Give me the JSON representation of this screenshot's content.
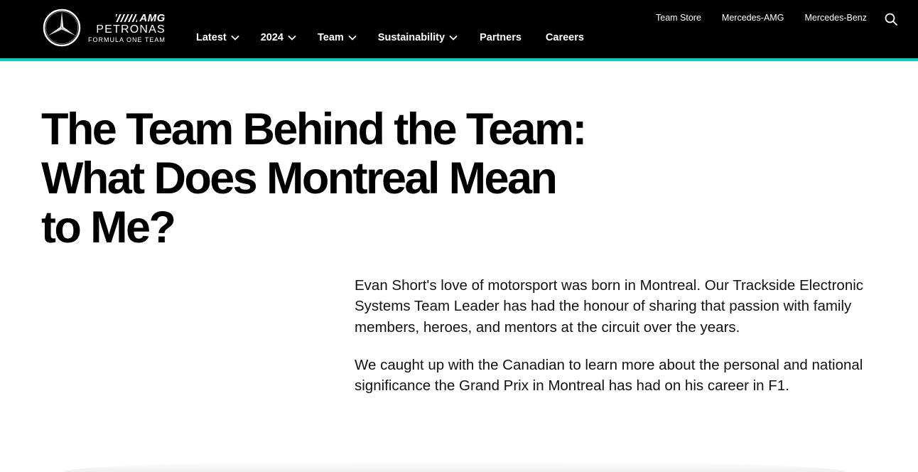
{
  "brand": {
    "amg": "AMG",
    "petronas": "PETRONAS",
    "subtitle": "FORMULA ONE TEAM"
  },
  "colors": {
    "header_bg": "#000000",
    "accent": "#00d2be",
    "text": "#000000"
  },
  "main_nav": {
    "items": [
      {
        "label": "Latest",
        "has_dropdown": true
      },
      {
        "label": "2024",
        "has_dropdown": true
      },
      {
        "label": "Team",
        "has_dropdown": true
      },
      {
        "label": "Sustainability",
        "has_dropdown": true
      },
      {
        "label": "Partners",
        "has_dropdown": false
      },
      {
        "label": "Careers",
        "has_dropdown": false
      }
    ]
  },
  "utility_nav": {
    "items": [
      {
        "label": "Team Store"
      },
      {
        "label": "Mercedes-AMG"
      },
      {
        "label": "Mercedes-Benz"
      }
    ],
    "search_icon": "search-icon"
  },
  "article": {
    "title_lines": [
      "The Team Behind the Team:",
      "What Does Montreal Mean",
      "to Me?"
    ],
    "paragraphs": [
      "Evan Short's love of motorsport was born in Montreal. Our Trackside Electronic Systems Team Leader has had the honour of sharing that passion with family members, heroes, and mentors at the circuit over the years.",
      "We caught up with the Canadian to learn more about the personal and national significance the Grand Prix in Montreal has had on his career in F1."
    ]
  }
}
